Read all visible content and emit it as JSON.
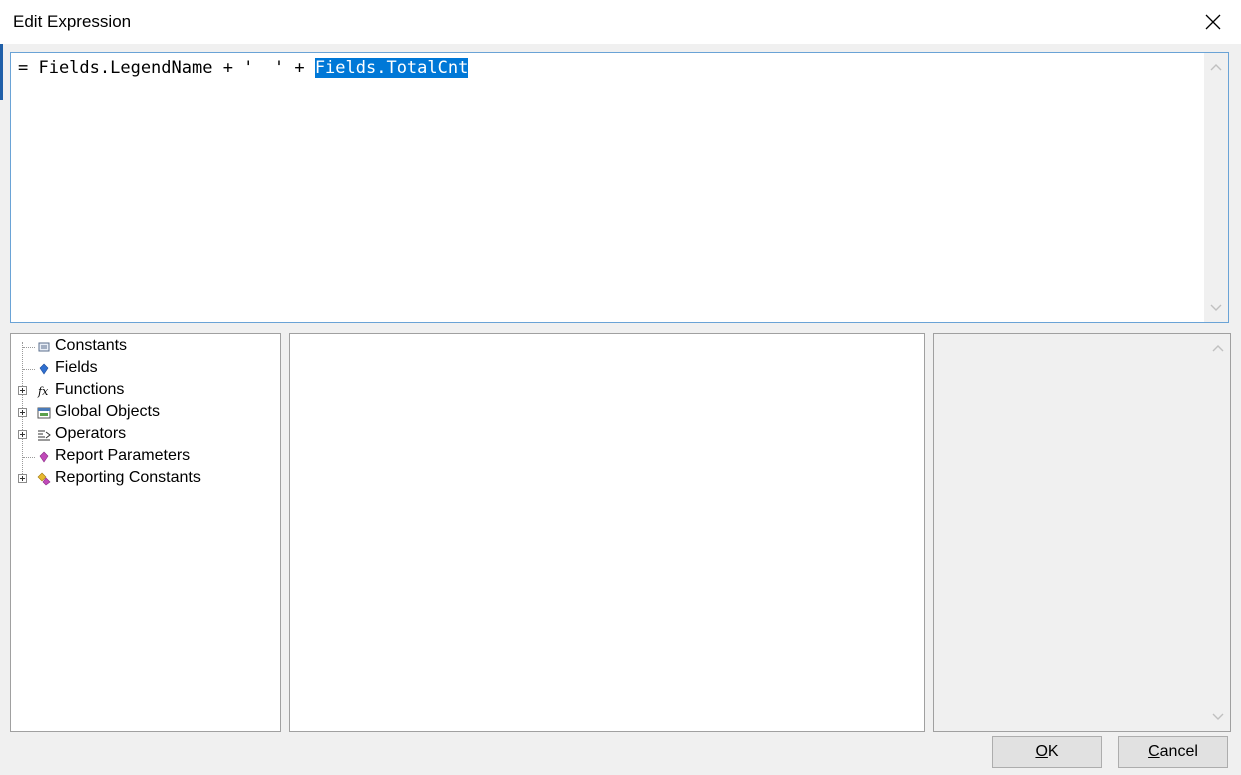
{
  "window": {
    "title": "Edit Expression",
    "close_icon": "close-icon"
  },
  "editor": {
    "expression_prefix": "= Fields.LegendName + '  ' + ",
    "expression_selected": "Fields.TotalCnt"
  },
  "tree": {
    "items": [
      {
        "label": "Constants",
        "icon": "constants-icon",
        "expandable": false
      },
      {
        "label": "Fields",
        "icon": "fields-icon",
        "expandable": false
      },
      {
        "label": "Functions",
        "icon": "function-icon",
        "expandable": true
      },
      {
        "label": "Global Objects",
        "icon": "global-objects-icon",
        "expandable": true
      },
      {
        "label": "Operators",
        "icon": "operators-icon",
        "expandable": true
      },
      {
        "label": "Report Parameters",
        "icon": "parameters-icon",
        "expandable": false
      },
      {
        "label": "Reporting Constants",
        "icon": "reporting-constants-icon",
        "expandable": true
      }
    ]
  },
  "buttons": {
    "ok_first": "O",
    "ok_rest": "K",
    "cancel_first": "C",
    "cancel_rest": "ancel"
  },
  "colors": {
    "selection": "#0078d7",
    "editor_border": "#6aa3d6",
    "window_bg": "#f0f0f0"
  }
}
